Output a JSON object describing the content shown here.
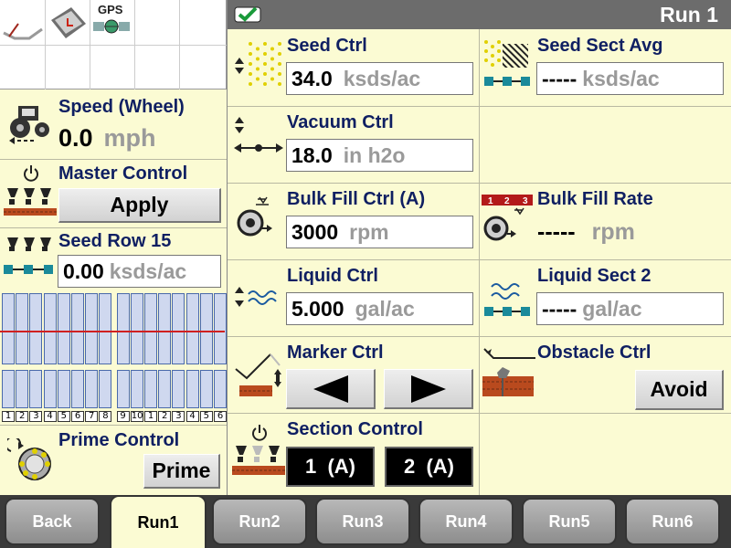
{
  "colors": {
    "background": "#fbfbd3",
    "label": "#0f1f62",
    "unit": "#9a9a9a",
    "header": "#6c6c6c",
    "tab": "#9a9a9a"
  },
  "status_bar": {
    "gps_label": "GPS"
  },
  "header": {
    "title": "Run 1",
    "check_icon": "green-check-icon"
  },
  "speed": {
    "label": "Speed (Wheel)",
    "value": "0.0",
    "unit": "mph"
  },
  "master_control": {
    "label": "Master Control",
    "button": "Apply"
  },
  "seed_row": {
    "label": "Seed Row 15",
    "value": "0.00",
    "unit": "ksds/ac"
  },
  "row_groups": [
    {
      "numbers": [
        "1",
        "2",
        "3",
        "4",
        "5",
        "6",
        "7",
        "8"
      ]
    },
    {
      "numbers": [
        "9",
        "10",
        "1",
        "2",
        "3",
        "4",
        "5",
        "6"
      ]
    }
  ],
  "prime_control": {
    "label": "Prime Control",
    "button": "Prime"
  },
  "seed_ctrl": {
    "label": "Seed Ctrl",
    "value": "34.0",
    "unit": "ksds/ac"
  },
  "seed_sect_avg": {
    "label": "Seed Sect Avg",
    "value": "-----",
    "unit": "ksds/ac"
  },
  "vacuum_ctrl": {
    "label": "Vacuum Ctrl",
    "value": "18.0",
    "unit": "in h2o"
  },
  "bulk_fill_ctrl": {
    "label": "Bulk Fill Ctrl (A)",
    "value": "3000",
    "unit": "rpm"
  },
  "bulk_fill_rate": {
    "label": "Bulk Fill Rate",
    "value": "-----",
    "unit": "rpm",
    "bar_labels": [
      "1",
      "2",
      "3"
    ]
  },
  "liquid_ctrl": {
    "label": "Liquid Ctrl",
    "value": "5.000",
    "unit": "gal/ac"
  },
  "liquid_sect": {
    "label": "Liquid Sect 2",
    "value": "-----",
    "unit": "gal/ac"
  },
  "marker_ctrl": {
    "label": "Marker Ctrl"
  },
  "obstacle_ctrl": {
    "label": "Obstacle Ctrl",
    "button": "Avoid"
  },
  "section_control": {
    "label": "Section Control",
    "sections": [
      "1  (A)",
      "2  (A)"
    ]
  },
  "tabs": [
    {
      "label": "Back",
      "active": false
    },
    {
      "label": "Run1",
      "active": true
    },
    {
      "label": "Run2",
      "active": false
    },
    {
      "label": "Run3",
      "active": false
    },
    {
      "label": "Run4",
      "active": false
    },
    {
      "label": "Run5",
      "active": false
    },
    {
      "label": "Run6",
      "active": false
    }
  ]
}
